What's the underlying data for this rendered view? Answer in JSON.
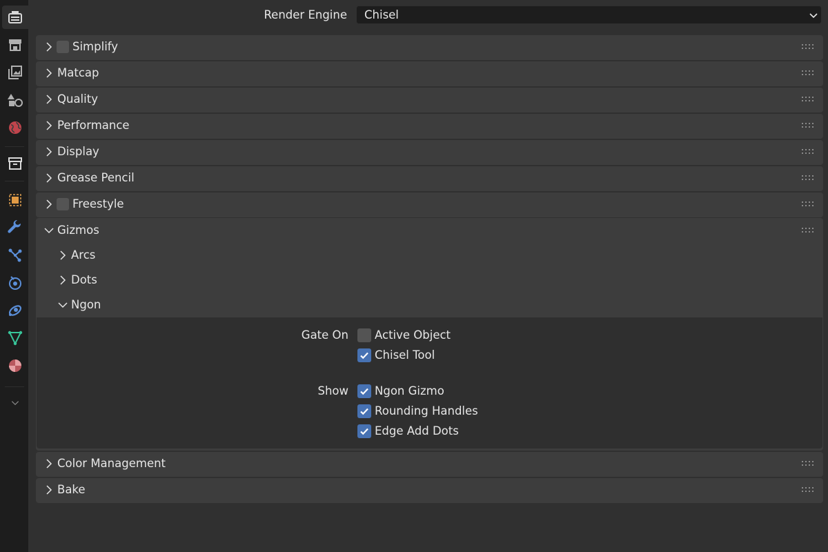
{
  "sidebar": {
    "tabs": [
      {
        "name": "render-properties-icon",
        "active": true
      },
      {
        "name": "output-properties-icon"
      },
      {
        "name": "view-layer-properties-icon"
      },
      {
        "name": "scene-properties-icon"
      },
      {
        "name": "world-properties-icon"
      },
      {
        "name": "collection-properties-icon"
      },
      {
        "name": "object-properties-icon"
      },
      {
        "name": "modifier-properties-icon"
      },
      {
        "name": "particles-properties-icon"
      },
      {
        "name": "physics-properties-icon"
      },
      {
        "name": "constraints-properties-icon"
      },
      {
        "name": "data-properties-icon"
      },
      {
        "name": "material-properties-icon"
      },
      {
        "name": "chevron-down-icon"
      }
    ]
  },
  "render_engine": {
    "label": "Render Engine",
    "value": "Chisel"
  },
  "panels": {
    "simplify": "Simplify",
    "matcap": "Matcap",
    "quality": "Quality",
    "performance": "Performance",
    "display": "Display",
    "grease_pencil": "Grease Pencil",
    "freestyle": "Freestyle",
    "gizmos": "Gizmos",
    "color_management": "Color Management",
    "bake": "Bake"
  },
  "gizmos": {
    "subpanels": {
      "arcs": "Arcs",
      "dots": "Dots",
      "ngon": "Ngon"
    },
    "ngon": {
      "gate_on_label": "Gate On",
      "show_label": "Show",
      "active_object": {
        "label": "Active Object",
        "checked": false
      },
      "chisel_tool": {
        "label": "Chisel Tool",
        "checked": true
      },
      "ngon_gizmo": {
        "label": "Ngon Gizmo",
        "checked": true
      },
      "rounding_handles": {
        "label": "Rounding Handles",
        "checked": true
      },
      "edge_add_dots": {
        "label": "Edge Add Dots",
        "checked": true
      }
    }
  },
  "colors": {
    "accent": "#4772b3",
    "panel": "#3d3d3d",
    "background": "#303030"
  }
}
